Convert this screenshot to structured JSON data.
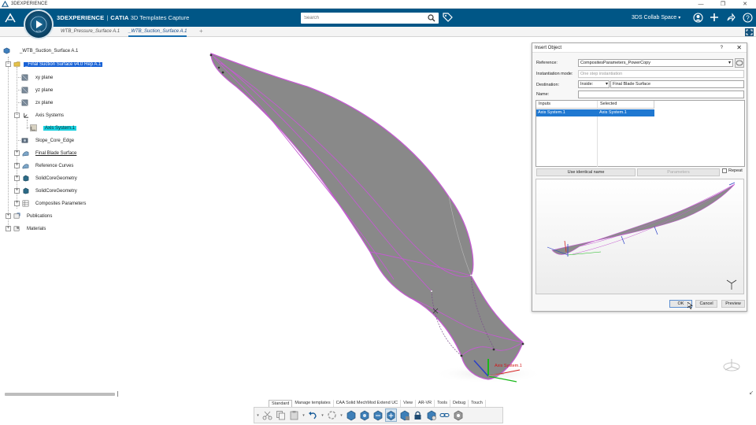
{
  "os": {
    "title": "3DEXPERIENCE",
    "controls": [
      "—",
      "❐",
      "✕"
    ]
  },
  "header": {
    "brand": "3DEXPERIENCE",
    "separator": "|",
    "app": "CATIA",
    "module": "3D Templates Capture",
    "compass_version": "V,R",
    "search_placeholder": "Search",
    "collab_space": "3DS Collab Space",
    "colors": {
      "bar": "#005686",
      "compass": "#0b3f5f"
    }
  },
  "tabs": [
    {
      "label": "WTB_Pressure_Surface A.1",
      "active": false
    },
    {
      "label": "_WTB_Suction_Surface A.1",
      "active": true
    }
  ],
  "tab_add": "+",
  "tree": {
    "root": "_WTB_Suction_Surface A.1",
    "rep": "_Final Suction Surface v4.0 Rep A.1",
    "xy": "xy plane",
    "yz": "yz plane",
    "zx": "zx plane",
    "axis_systems": "Axis Systems",
    "axis_system": "Axis System.1",
    "slope": "Slope_Core_Edge",
    "final_blade": "Final Blade Surface",
    "ref_curves": "Reference Curves",
    "solid1": "SolidCoreGeometry",
    "solid2": "SolidCoreGeometry",
    "composites": "Composites Parameters",
    "publications": "Publications",
    "materials": "Materials"
  },
  "dialog": {
    "title": "Insert Object",
    "help": "?",
    "close": "✕",
    "reference_label": "Reference:",
    "reference_value": "CompositesParameters_PowerCopy",
    "instantiation_label": "Instantiation mode:",
    "instantiation_value": "One step instantiation",
    "destination_label": "Destination:",
    "destination_mode": "Inside:",
    "destination_value": "Final Blade Surface",
    "name_label": "Name:",
    "name_value": "",
    "col_inputs": "Inputs",
    "col_selected": "Selected",
    "row_input": "Axis System.1",
    "row_selected": "Axis System.1",
    "use_identical": "Use identical name",
    "parameters": "Parameters",
    "repeat": "Repeat",
    "repeat_checked": false,
    "ok": "OK",
    "cancel": "Cancel",
    "preview": "Preview"
  },
  "viewport": {
    "axis_label": "Axis System.1"
  },
  "toolbar_tabs": [
    {
      "label": "Standard",
      "active": true
    },
    {
      "label": "Manage templates",
      "active": false
    },
    {
      "label": "CAA Solid MechMod Extend UC",
      "active": false
    },
    {
      "label": "View",
      "active": false
    },
    {
      "label": "AR-VR",
      "active": false
    },
    {
      "label": "Tools",
      "active": false
    },
    {
      "label": "Debug",
      "active": false
    },
    {
      "label": "Touch",
      "active": false
    }
  ]
}
